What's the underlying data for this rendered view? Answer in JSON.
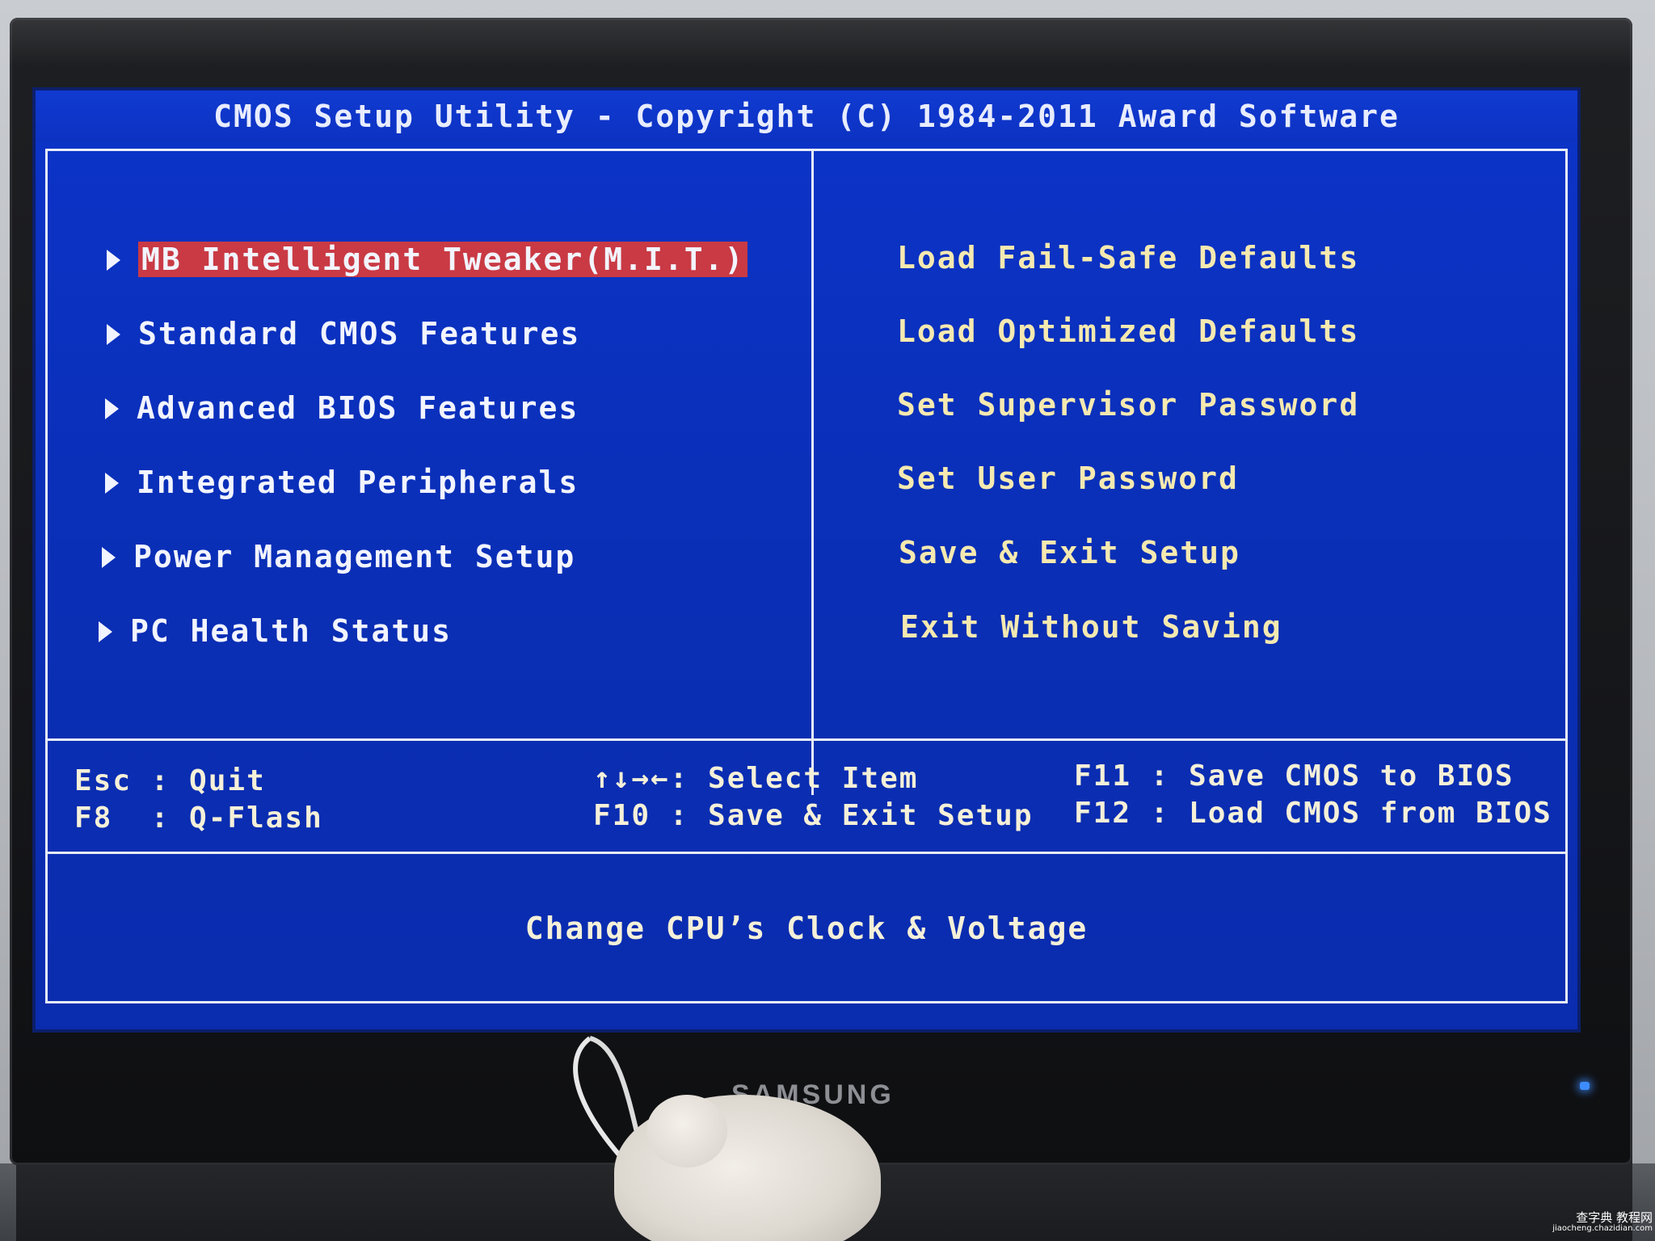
{
  "bios": {
    "title": "CMOS Setup Utility - Copyright (C) 1984-2011 Award Software",
    "left_menu": [
      {
        "label": "MB Intelligent Tweaker(M.I.T.)",
        "selected": true
      },
      {
        "label": "Standard CMOS Features",
        "selected": false
      },
      {
        "label": "Advanced BIOS Features",
        "selected": false
      },
      {
        "label": "Integrated Peripherals",
        "selected": false
      },
      {
        "label": "Power Management Setup",
        "selected": false
      },
      {
        "label": "PC Health Status",
        "selected": false
      }
    ],
    "right_menu": [
      {
        "label": "Load Fail-Safe Defaults"
      },
      {
        "label": "Load Optimized Defaults"
      },
      {
        "label": "Set Supervisor Password"
      },
      {
        "label": "Set User Password"
      },
      {
        "label": "Save & Exit Setup"
      },
      {
        "label": "Exit Without Saving"
      }
    ],
    "keys": {
      "esc": "Esc : Quit",
      "f8": "F8  : Q-Flash",
      "select": "↑↓→←: Select Item",
      "f10": "F10 : Save & Exit Setup",
      "f11": "F11 : Save CMOS to BIOS",
      "f12": "F12 : Load CMOS from BIOS"
    },
    "help_text": "Change CPU’s Clock & Voltage"
  },
  "monitor": {
    "brand": "SAMSUNG"
  },
  "watermark": {
    "line1": "查字典 教程网",
    "line2": "jiaocheng.chazidian.com"
  },
  "colors": {
    "screen_blue": "#0a2fb8",
    "selection_red": "#c93a44",
    "right_menu_yellow": "#f5e9b0",
    "frame_white": "#e8eef8",
    "power_led": "#3d8cff"
  }
}
